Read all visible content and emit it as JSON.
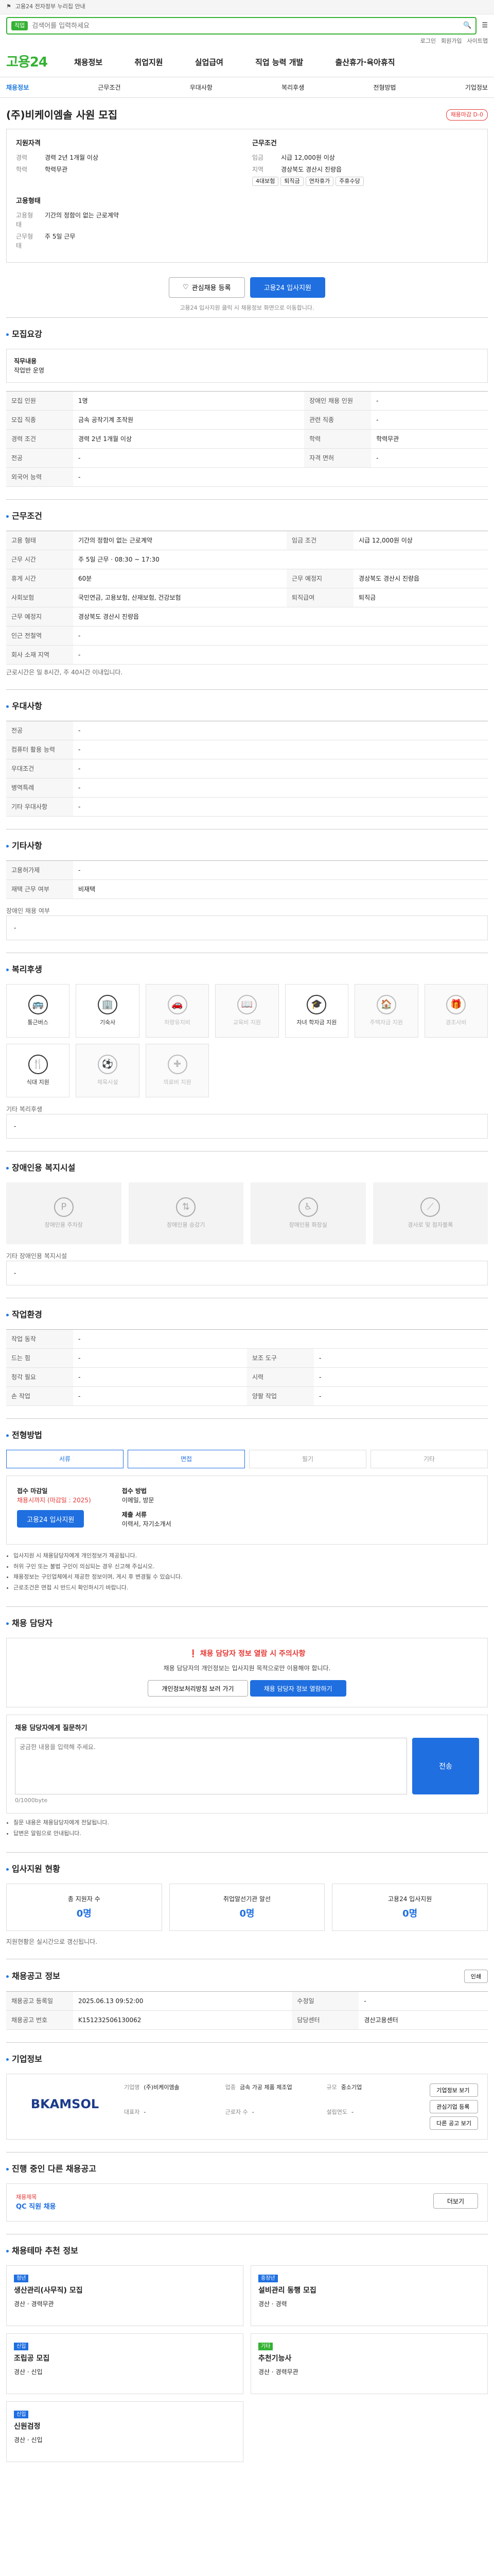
{
  "topbar": {
    "notice": "고용24 전자정부 누리집 안내",
    "menu": "전체메뉴"
  },
  "search": {
    "tag": "직업",
    "placeholder": "검색어를 입력하세요",
    "value": ""
  },
  "util": {
    "login": "로그인",
    "join": "회원가입",
    "sitemap": "사이트맵"
  },
  "brand": {
    "logo_a": "고용",
    "logo_b": "24"
  },
  "gnb": [
    "채용정보",
    "취업지원",
    "실업급여",
    "직업 능력 개발",
    "출산휴가·육아휴직"
  ],
  "subnav": [
    "채용정보",
    "근무조건",
    "우대사항",
    "복리후생",
    "전형방법",
    "기업정보"
  ],
  "job": {
    "title": "(주)비케이엠솔 사원 모집",
    "status": "채용마감 D-0"
  },
  "summary": {
    "apply_label": "지원자격",
    "career_k": "경력",
    "career_v": "경력 2년 1개월 이상",
    "edu_k": "학력",
    "edu_v": "학력무관",
    "work_label": "근무조건",
    "wage_k": "임금",
    "wage_v": "시급 12,000원 이상",
    "region_k": "지역",
    "region_v": "경상북도 경산시 진량읍",
    "type_label": "고용형태",
    "type_k": "고용형태",
    "type_v": "기간의 정함이 없는 근로계약",
    "shift_k": "근무형태",
    "shift_v": "주 5일 근무",
    "chips": [
      "4대보험",
      "퇴직금",
      "연차휴가",
      "주휴수당"
    ]
  },
  "actions": {
    "scrap": "관심채용 등록",
    "apply": "고용24 입사지원"
  },
  "note": "고용24 입사지원 클릭 시 채용정보 화면으로 이동합니다.",
  "recruit": {
    "title": "모집요강",
    "duty_label": "직무내용",
    "duty_text": "작업반 운영",
    "rows": [
      {
        "k": "모집 인원",
        "v": "1명",
        "k2": "장애인 채용 인원",
        "v2": "-"
      },
      {
        "k": "모집 직종",
        "v": "금속 공작기계 조작원",
        "k2": "관련 직종",
        "v2": "-"
      },
      {
        "k": "경력 조건",
        "v": "경력 2년 1개월 이상",
        "k2": "학력",
        "v2": "학력무관"
      },
      {
        "k": "전공",
        "v": "-",
        "k2": "자격 면허",
        "v2": "-"
      },
      {
        "k": "외국어 능력",
        "v": "-",
        "k2": "",
        "v2": ""
      }
    ]
  },
  "work": {
    "title": "근무조건",
    "rows": [
      {
        "k": "고용 형태",
        "v": "기간의 정함이 없는 근로계약",
        "k2": "임금 조건",
        "v2": "시급 12,000원 이상"
      },
      {
        "k": "근무 시간",
        "v": "주 5일 근무 · 08:30 ~ 17:30",
        "k2": "",
        "v2": ""
      },
      {
        "k": "휴게 시간",
        "v": "60분",
        "k2": "근무 예정지",
        "v2": "경상북도 경산시 진량읍"
      },
      {
        "k": "사회보험",
        "v": "국민연금, 고용보험, 산재보험, 건강보험",
        "k2": "퇴직급여",
        "v2": "퇴직금"
      },
      {
        "k": "근무 예정지",
        "v": "경상북도 경산시 진량읍",
        "k2": "",
        "v2": ""
      },
      {
        "k": "인근 전철역",
        "v": "-",
        "k2": "",
        "v2": ""
      },
      {
        "k": "회사 소재 지역",
        "v": "-",
        "k2": "",
        "v2": ""
      }
    ],
    "footnote": "근로시간은 일 8시간, 주 40시간 이내입니다."
  },
  "prefer": {
    "title": "우대사항",
    "rows": [
      {
        "k": "전공",
        "v": "-"
      },
      {
        "k": "컴퓨터 활용 능력",
        "v": "-"
      },
      {
        "k": "우대조건",
        "v": "-"
      },
      {
        "k": "병역특례",
        "v": "-"
      },
      {
        "k": "기타 우대사항",
        "v": "-"
      }
    ]
  },
  "etc": {
    "title": "기타사항",
    "rows": [
      {
        "k": "고용허가제",
        "v": "-"
      },
      {
        "k": "재택 근무 여부",
        "v": "비재택"
      }
    ],
    "sub": "장애인 채용 여부",
    "box": "-"
  },
  "welfare": {
    "title": "복리후생",
    "items": [
      {
        "label": "통근버스",
        "icon": "bus-icon",
        "on": true
      },
      {
        "label": "기숙사",
        "icon": "building-icon",
        "on": true
      },
      {
        "label": "차량유지비",
        "icon": "car-icon",
        "on": false
      },
      {
        "label": "교육비 지원",
        "icon": "book-icon",
        "on": false
      },
      {
        "label": "자녀 학자금 지원",
        "icon": "graduation-icon",
        "on": true
      },
      {
        "label": "주택자금 지원",
        "icon": "house-icon",
        "on": false
      },
      {
        "label": "경조사비",
        "icon": "gift-icon",
        "on": false
      },
      {
        "label": "식대 지원",
        "icon": "food-icon",
        "on": true
      },
      {
        "label": "체육시설",
        "icon": "sport-icon",
        "on": false
      },
      {
        "label": "의료비 지원",
        "icon": "medical-icon",
        "on": false
      }
    ],
    "caption": "기타 복리후생",
    "box": "-"
  },
  "access": {
    "title": "장애인용 복지시설",
    "items": [
      "장애인용 주차장",
      "장애인용 승강기",
      "장애인용 화장실",
      "경사로 및 점자블록"
    ],
    "caption": "기타 장애인용 복지시설",
    "box": "-"
  },
  "env": {
    "title": "작업환경",
    "rows": [
      {
        "k": "작업 동작",
        "v": "-",
        "k2": "",
        "v2": ""
      },
      {
        "k": "드는 힘",
        "v": "-",
        "k2": "보조 도구",
        "v2": "-"
      },
      {
        "k": "청각 필요",
        "v": "-",
        "k2": "시력",
        "v2": "-"
      },
      {
        "k": "손 작업",
        "v": "-",
        "k2": "양팔 작업",
        "v2": "-"
      }
    ]
  },
  "method": {
    "title": "전형방법",
    "steps": [
      "서류",
      "면접",
      "필기",
      "기타"
    ],
    "deadline_k": "접수 마감일",
    "deadline_v": "채용시까지 (마감일 : 2025)",
    "way_k": "접수 방법",
    "way_v": "이메일, 방문",
    "docs_k": "제출 서류",
    "docs_v": "이력서, 자기소개서",
    "apply_btn": "고용24 입사지원",
    "bullets": [
      "입사지원 시 채용담당자에게 개인정보가 제공됩니다.",
      "허위 구인 또는 불법 구인이 의심되는 경우 신고해 주십시오.",
      "채용정보는 구인업체에서 제공한 정보이며, 게시 후 변경될 수 있습니다.",
      "근로조건은 면접 시 반드시 확인하시기 바랍니다."
    ]
  },
  "contact": {
    "title": "채용 담당자",
    "warn_title": "채용 담당자 정보 열람 시 주의사항",
    "warn_text": "채용 담당자의 개인정보는 입사지원 목적으로만 이용해야 합니다.",
    "btn_a": "개인정보처리방침 보러 가기",
    "btn_b": "채용 담당자 정보 열람하기",
    "inq_label": "채용 담당자에게 질문하기",
    "inq_placeholder": "궁금한 내용을 입력해 주세요.",
    "inq_count": "0/1000byte",
    "inq_btn": "전송",
    "bullets": [
      "질문 내용은 채용담당자에게 전달됩니다.",
      "답변은 알림으로 안내됩니다."
    ]
  },
  "stats": {
    "title": "입사지원 현황",
    "items": [
      {
        "k": "총 지원자 수",
        "v": "0명"
      },
      {
        "k": "취업알선기관 알선",
        "v": "0명"
      },
      {
        "k": "고용24 입사지원",
        "v": "0명"
      }
    ],
    "note": "지원현황은 실시간으로 갱신됩니다."
  },
  "posting": {
    "title": "채용공고 정보",
    "btn": "인쇄",
    "rows": [
      {
        "k": "채용공고 등록일",
        "v": "2025.06.13 09:52:00",
        "k2": "수정일",
        "v2": "-"
      },
      {
        "k": "채용공고 번호",
        "v": "K151232506130062",
        "k2": "담당센터",
        "v2": "경산고용센터"
      }
    ]
  },
  "company": {
    "title": "기업정보",
    "logo": "BKAMSOL",
    "info": [
      {
        "k": "기업명",
        "v": "(주)비케이엠솔"
      },
      {
        "k": "업종",
        "v": "금속 가공 제품 제조업"
      },
      {
        "k": "규모",
        "v": "중소기업"
      },
      {
        "k": "대표자",
        "v": "-"
      },
      {
        "k": "근로자 수",
        "v": "-"
      },
      {
        "k": "설립연도",
        "v": "-"
      }
    ],
    "btn_a": "기업정보 보기",
    "btn_b": "관심기업 등록",
    "btn_c": "다른 공고 보기"
  },
  "other": {
    "title": "진행 중인 다른 채용공고",
    "name": "채용제목",
    "desc": "QC 직원 채용",
    "btn": "더보기"
  },
  "reco": {
    "title": "채용테마 추천 정보",
    "items": [
      {
        "tag": "청년",
        "title": "생산관리(사무직) 모집",
        "meta": "경산 · 경력무관"
      },
      {
        "tag": "중장년",
        "title": "설비관리 동행 모집",
        "meta": "경산 · 경력"
      },
      {
        "tag": "신입",
        "title": "조립공 모집",
        "meta": "경산 · 신입"
      },
      {
        "tag": "기타",
        "title": "추천기능사",
        "meta": "경산 · 경력무관"
      },
      {
        "tag": "신입",
        "title": "신원검정",
        "meta": "경산 · 신입"
      }
    ]
  }
}
